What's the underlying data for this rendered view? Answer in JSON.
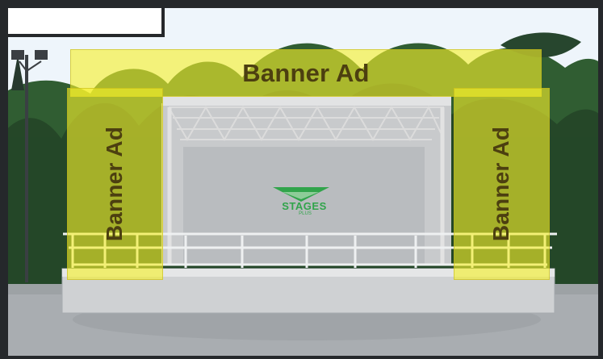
{
  "scene": {
    "banners": {
      "top": "Banner Ad",
      "left": "Banner Ad",
      "right": "Banner Ad"
    },
    "logo": {
      "name": "STAGES",
      "subtext": "PLUS"
    },
    "colors": {
      "banner_fill": "#f5f12a",
      "banner_text": "#4c3f10",
      "stage_gray": "#c9cbcd",
      "sky": "#e8f2fa",
      "tree_dark": "#1f3f22",
      "tree_mid": "#2f5a2f",
      "truss": "#d7d7d7"
    }
  }
}
